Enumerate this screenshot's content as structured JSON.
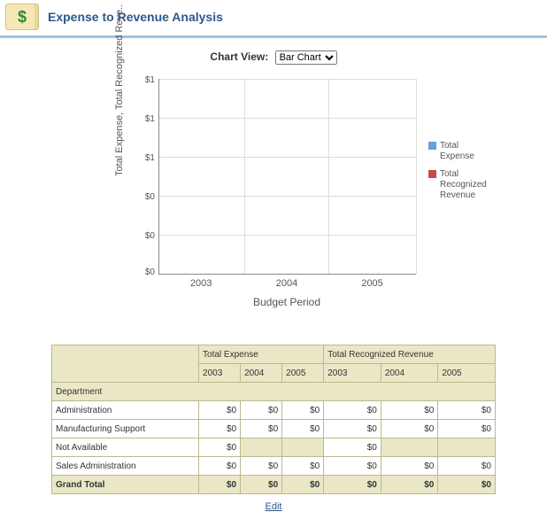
{
  "header": {
    "title": "Expense to Revenue Analysis",
    "icon_glyph": "$"
  },
  "chart_view": {
    "label": "Chart View:",
    "selected": "Bar Chart",
    "options": [
      "Bar Chart"
    ]
  },
  "chart_data": {
    "type": "bar",
    "title": "",
    "xlabel": "Budget Period",
    "ylabel": "Total Expense, Total Recognized Reve..",
    "categories": [
      "2003",
      "2004",
      "2005"
    ],
    "series": [
      {
        "name": "Total Expense",
        "values": [
          0,
          0,
          0
        ],
        "color": "#6aa0d8"
      },
      {
        "name": "Total Recognized Revenue",
        "values": [
          0,
          0,
          0
        ],
        "color": "#c84a4a"
      }
    ],
    "ylim": [
      0,
      1
    ],
    "y_tick_labels": [
      "$1",
      "$1",
      "$1",
      "$0",
      "$0",
      "$0"
    ]
  },
  "legend": {
    "item1_line1": "Total",
    "item1_line2": "Expense",
    "item2_line1": "Total",
    "item2_line2": "Recognized",
    "item2_line3": "Revenue"
  },
  "table": {
    "metric1": "Total Expense",
    "metric2": "Total Recognized Revenue",
    "years": [
      "2003",
      "2004",
      "2005"
    ],
    "row_group_label": "Department",
    "rows": [
      {
        "label": "Administration",
        "exp": [
          "$0",
          "$0",
          "$0"
        ],
        "rev": [
          "$0",
          "$0",
          "$0"
        ]
      },
      {
        "label": "Manufacturing Support",
        "exp": [
          "$0",
          "$0",
          "$0"
        ],
        "rev": [
          "$0",
          "$0",
          "$0"
        ]
      },
      {
        "label": "Not Available",
        "exp": [
          "$0",
          null,
          null
        ],
        "rev": [
          "$0",
          null,
          null
        ]
      },
      {
        "label": "Sales Administration",
        "exp": [
          "$0",
          "$0",
          "$0"
        ],
        "rev": [
          "$0",
          "$0",
          "$0"
        ]
      }
    ],
    "grand": {
      "label": "Grand Total",
      "exp": [
        "$0",
        "$0",
        "$0"
      ],
      "rev": [
        "$0",
        "$0",
        "$0"
      ]
    }
  },
  "edit_link": "Edit"
}
